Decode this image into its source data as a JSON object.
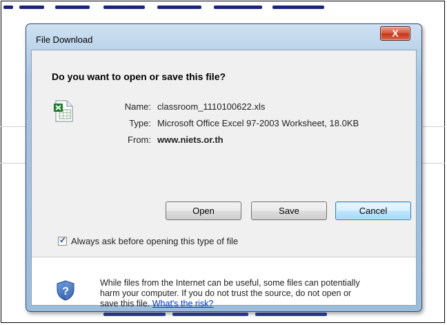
{
  "dialog": {
    "title": "File Download",
    "close_label": "X",
    "question": "Do you want to open or save this file?",
    "file_icon": "excel-file-icon",
    "fields": {
      "name_label": "Name:",
      "name_value": "classroom_1110100622.xls",
      "type_label": "Type:",
      "type_value": "Microsoft Office Excel 97-2003 Worksheet, 18.0KB",
      "from_label": "From:",
      "from_value": "www.niets.or.th"
    },
    "buttons": {
      "open": "Open",
      "save": "Save",
      "cancel": "Cancel"
    },
    "checkbox": {
      "label": "Always ask before opening this type of file",
      "checked": true
    },
    "warning": {
      "icon": "security-shield-question-icon",
      "line1": "While files from the Internet can be useful, some files can potentially",
      "line2": "harm your computer. If you do not trust the source, do not open or",
      "line3": "save this file.",
      "link": "What's the risk?"
    }
  },
  "colors": {
    "frame": "#a8c6e2",
    "close_button": "#c33519",
    "default_button": "#bee6fd",
    "link": "#0033cc"
  }
}
